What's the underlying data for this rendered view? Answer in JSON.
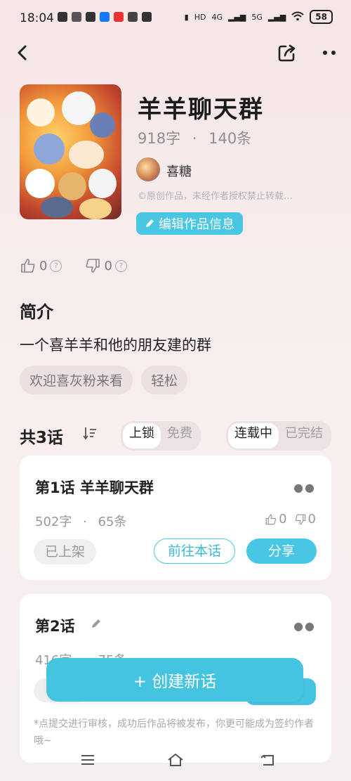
{
  "status_bar": {
    "time": "18:04",
    "battery": "58",
    "network_labels": [
      "HD",
      "4G",
      "5G"
    ]
  },
  "nav": {
    "back_icon": "chevron-left-icon",
    "share_icon": "share-icon",
    "more_icon": "more-horizontal-icon"
  },
  "work": {
    "title": "羊羊聊天群",
    "word_count": "918字",
    "separator": "·",
    "message_count": "140条",
    "author_name": "喜糖",
    "copyright": "©原创作品，未经作者授权禁止转载…",
    "edit_label": "编辑作品信息",
    "likes": "0",
    "dislikes": "0"
  },
  "intro": {
    "heading": "简介",
    "text": "一个喜羊羊和他的朋友建的群",
    "tags": [
      "欢迎喜灰粉来看",
      "轻松"
    ]
  },
  "episodes": {
    "count_label": "共3话",
    "filter_a": [
      "上锁",
      "免费"
    ],
    "filter_b": [
      "连载中",
      "已完结"
    ],
    "items": [
      {
        "title": "第1话  羊羊聊天群",
        "words": "502字",
        "sep": "·",
        "messages": "65条",
        "likes": "0",
        "dislikes": "0",
        "status": "已上架",
        "goto": "前往本话",
        "share": "分享"
      },
      {
        "title": "第2话",
        "words": "416字",
        "sep": "·",
        "messages": "75条"
      }
    ]
  },
  "create_button": "+ 创建新话",
  "note": "*点提交进行审核，成功后作品将被发布，你更可能成为签约作者哦~",
  "colors": {
    "accent": "#48c6e4",
    "background": "#f6e8e8"
  }
}
